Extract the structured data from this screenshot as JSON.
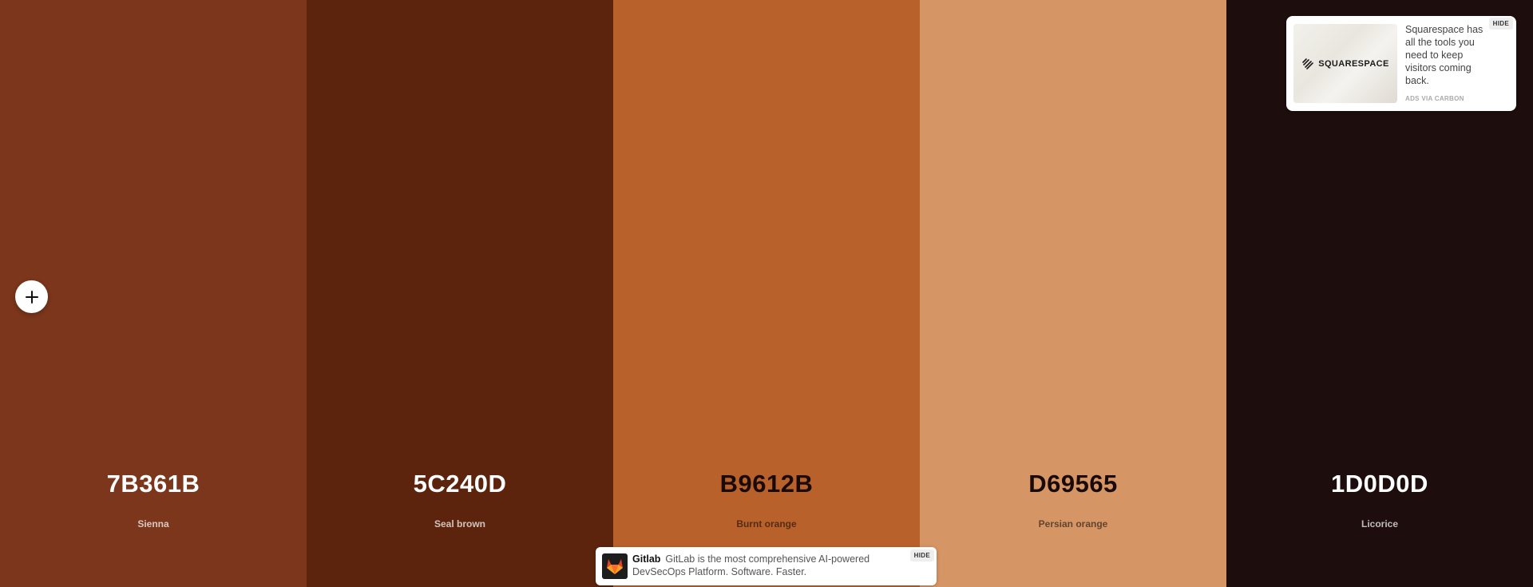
{
  "palette": {
    "colors": [
      {
        "hex": "7B361B",
        "name": "Sienna",
        "color": "#7B361B"
      },
      {
        "hex": "5C240D",
        "name": "Seal brown",
        "color": "#5C240D"
      },
      {
        "hex": "B9612B",
        "name": "Burnt orange",
        "color": "#B9612B"
      },
      {
        "hex": "D69565",
        "name": "Persian orange",
        "color": "#D69565"
      },
      {
        "hex": "1D0D0D",
        "name": "Licorice",
        "color": "#1D0D0D"
      }
    ],
    "add_icon": "plus-icon"
  },
  "carbon_ad": {
    "logo_text": "SQUARESPACE",
    "text": "Squarespace has all the tools you need to keep visitors coming back.",
    "via": "ADS VIA CARBON",
    "hide_label": "HIDE"
  },
  "gitlab_ad": {
    "brand": "Gitlab",
    "text": "GitLab is the most comprehensive AI-powered DevSecOps Platform. Software. Faster.",
    "hide_label": "HIDE"
  }
}
